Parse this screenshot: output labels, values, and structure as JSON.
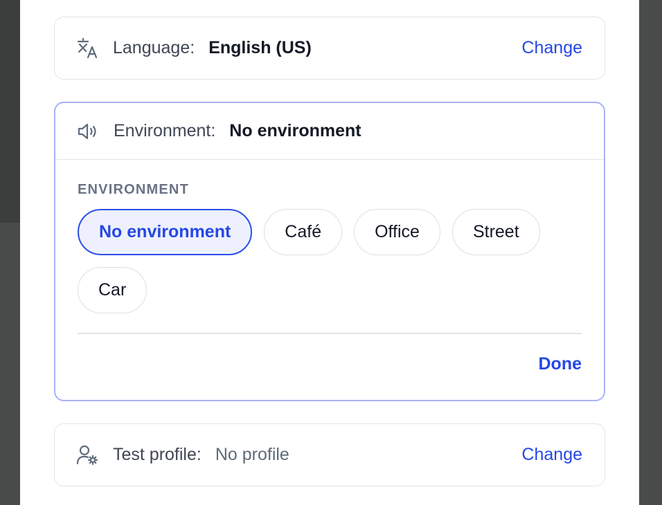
{
  "language": {
    "icon": "translate-icon",
    "label": "Language:",
    "value": "English (US)",
    "change_label": "Change"
  },
  "environment": {
    "icon": "speaker-icon",
    "label": "Environment:",
    "value": "No environment",
    "section_title": "ENVIRONMENT",
    "options": [
      {
        "label": "No environment",
        "selected": true
      },
      {
        "label": "Café",
        "selected": false
      },
      {
        "label": "Office",
        "selected": false
      },
      {
        "label": "Street",
        "selected": false
      },
      {
        "label": "Car",
        "selected": false
      }
    ],
    "done_label": "Done"
  },
  "profile": {
    "icon": "user-settings-icon",
    "label": "Test profile:",
    "value": "No profile",
    "change_label": "Change"
  },
  "colors": {
    "accent": "#2547e5",
    "selected_bg": "#eef1fd",
    "active_border": "#a7b2f5"
  }
}
